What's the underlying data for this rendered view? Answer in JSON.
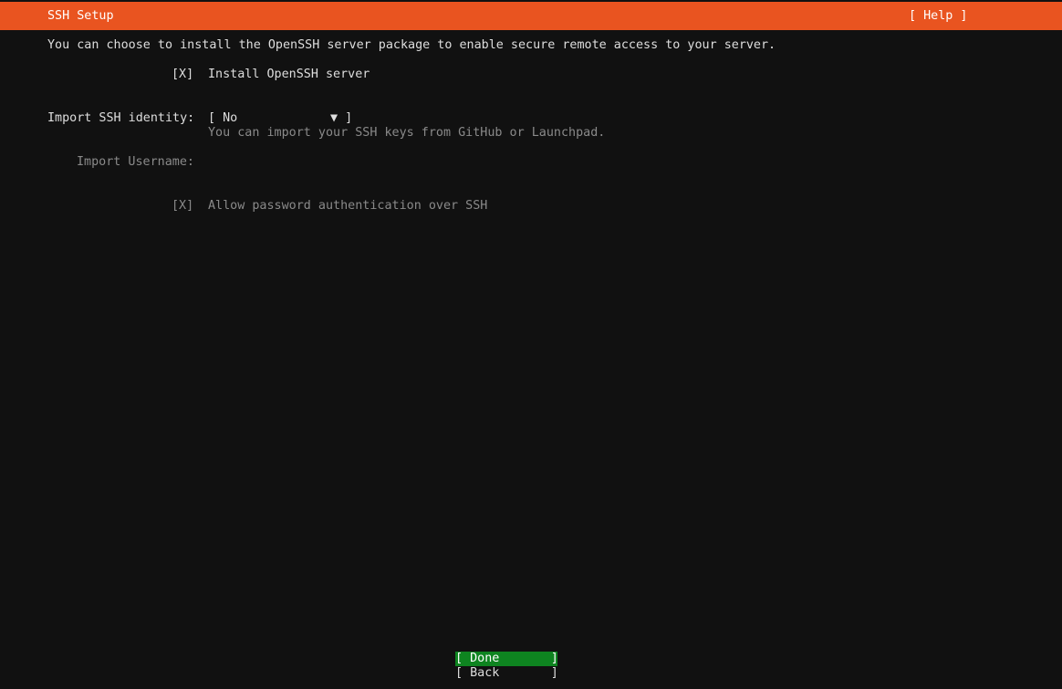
{
  "header": {
    "title": "SSH Setup",
    "help_label": "[ Help ]",
    "background_color": "#e95420"
  },
  "intro_text": "You can choose to install the OpenSSH server package to enable secure remote access to your server.",
  "install_openssh": {
    "checkbox": "[X]",
    "label": "Install OpenSSH server",
    "checked": true
  },
  "import_identity": {
    "label": "Import SSH identity:",
    "select_open": "[ No",
    "select_arrow": "▼ ]",
    "selected_value": "No",
    "hint": "You can import your SSH keys from GitHub or Launchpad."
  },
  "import_username": {
    "label": "Import Username:",
    "value": ""
  },
  "allow_password": {
    "checkbox": "[X]",
    "label": "Allow password authentication over SSH",
    "checked": true
  },
  "buttons": {
    "done_label": "[ Done       ]",
    "back_label": "[ Back       ]",
    "done_color": "#0e8420"
  }
}
